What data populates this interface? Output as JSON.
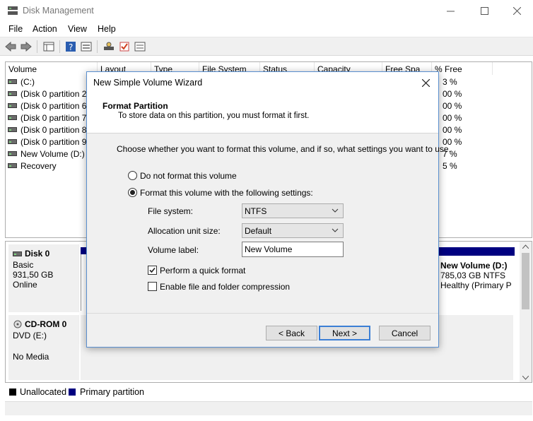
{
  "window": {
    "title": "Disk Management"
  },
  "menu": [
    "File",
    "Action",
    "View",
    "Help"
  ],
  "toolbar_icons": [
    "back-arrow-icon",
    "forward-arrow-icon",
    "console-tree-icon",
    "help-icon",
    "properties-icon",
    "rescan-disks-icon",
    "check-icon",
    "list-view-icon"
  ],
  "volume_list": {
    "columns": [
      "Volume",
      "Layout",
      "Type",
      "File System",
      "Status",
      "Capacity",
      "Free Spa",
      "% Free"
    ],
    "rows": [
      {
        "volume": "(C:)",
        "pct": "3 %"
      },
      {
        "volume": "(Disk 0 partition 2)",
        "pct": "00 %"
      },
      {
        "volume": "(Disk 0 partition 6)",
        "pct": "00 %"
      },
      {
        "volume": "(Disk 0 partition 7)",
        "pct": "00 %"
      },
      {
        "volume": "(Disk 0 partition 8)",
        "pct": "00 %"
      },
      {
        "volume": "(Disk 0 partition 9)",
        "pct": "00 %"
      },
      {
        "volume": "New Volume (D:)",
        "pct": "7 %"
      },
      {
        "volume": "Recovery",
        "pct": "5 %"
      }
    ]
  },
  "disks": {
    "disk0": {
      "name": "Disk 0",
      "type": "Basic",
      "size": "931,50 GB",
      "status": "Online"
    },
    "cdrom0": {
      "name": "CD-ROM 0",
      "drive": "DVD (E:)",
      "media": "No Media"
    },
    "new_volume": {
      "name": "New Volume  (D:)",
      "size": "785,03 GB NTFS",
      "status": "Healthy (Primary P"
    }
  },
  "legend": {
    "unallocated": "Unallocated",
    "primary": "Primary partition",
    "unallocated_color": "#000000",
    "primary_color": "#000080"
  },
  "dialog": {
    "title": "New Simple Volume Wizard",
    "heading": "Format Partition",
    "subheading": "To store data on this partition, you must format it first.",
    "intro": "Choose whether you want to format this volume, and if so, what settings you want to use.",
    "radio_no_format": "Do not format this volume",
    "radio_format": "Format this volume with the following settings:",
    "fs_label": "File system:",
    "fs_value": "NTFS",
    "alloc_label": "Allocation unit size:",
    "alloc_value": "Default",
    "vol_label": "Volume label:",
    "vol_value": "New Volume",
    "quick_format": "Perform a quick format",
    "compression": "Enable file and folder compression",
    "back": "< Back",
    "next": "Next >",
    "cancel": "Cancel"
  }
}
